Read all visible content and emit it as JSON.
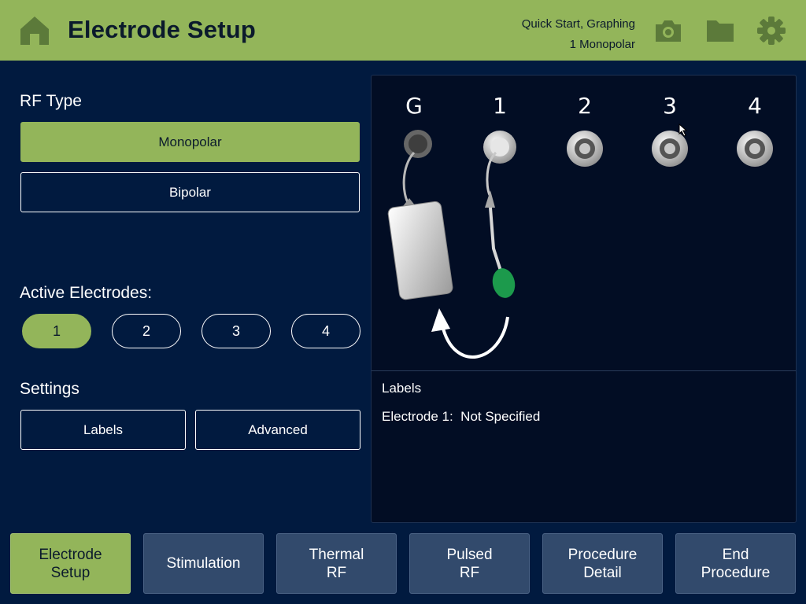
{
  "header": {
    "title": "Electrode Setup",
    "status_line1": "Quick Start, Graphing",
    "status_line2": "1 Monopolar",
    "icons": [
      "home-icon",
      "camera-icon",
      "folder-icon",
      "gear-icon"
    ],
    "accent_color": "#93b55a"
  },
  "left": {
    "rf_type_label": "RF Type",
    "rf_options": [
      {
        "label": "Monopolar",
        "selected": true
      },
      {
        "label": "Bipolar",
        "selected": false
      }
    ],
    "active_label": "Active Electrodes:",
    "active_options": [
      {
        "label": "1",
        "selected": true
      },
      {
        "label": "2",
        "selected": false
      },
      {
        "label": "3",
        "selected": false
      },
      {
        "label": "4",
        "selected": false
      }
    ],
    "settings_label": "Settings",
    "settings_buttons": [
      "Labels",
      "Advanced"
    ]
  },
  "diagram": {
    "ports": [
      "G",
      "1",
      "2",
      "3",
      "4"
    ],
    "labels_title": "Labels",
    "electrode_line": "Electrode 1:  Not Specified"
  },
  "nav": [
    {
      "label": "Electrode\nSetup",
      "selected": true
    },
    {
      "label": "Stimulation",
      "selected": false
    },
    {
      "label": "Thermal\nRF",
      "selected": false
    },
    {
      "label": "Pulsed\nRF",
      "selected": false
    },
    {
      "label": "Procedure\nDetail",
      "selected": false
    },
    {
      "label": "End\nProcedure",
      "selected": false
    }
  ]
}
